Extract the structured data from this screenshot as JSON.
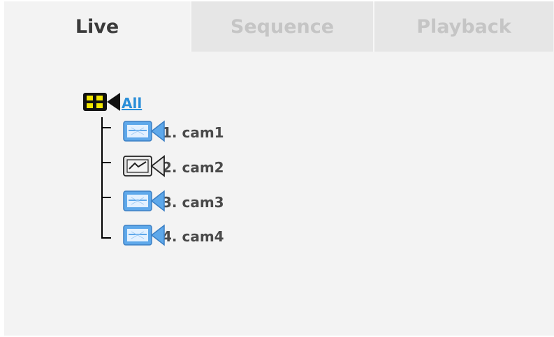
{
  "tabs": [
    {
      "label": "Live",
      "active": true
    },
    {
      "label": "Sequence",
      "active": false
    },
    {
      "label": "Playback",
      "active": false
    }
  ],
  "tree": {
    "root": {
      "label": "All",
      "icon": "multi-camera-icon"
    },
    "cameras": [
      {
        "label": "1. cam1",
        "icon": "camera-online-icon"
      },
      {
        "label": "2. cam2",
        "icon": "camera-offline-icon"
      },
      {
        "label": "3. cam3",
        "icon": "camera-online-icon"
      },
      {
        "label": "4. cam4",
        "icon": "camera-online-icon"
      }
    ]
  },
  "colors": {
    "panel_bg": "#f3f3f3",
    "inactive_tab_bg": "#e6e6e6",
    "root_link": "#2a8ed8",
    "camera_online": "#5ea8ea",
    "camera_offline": "#e6e6e6"
  }
}
